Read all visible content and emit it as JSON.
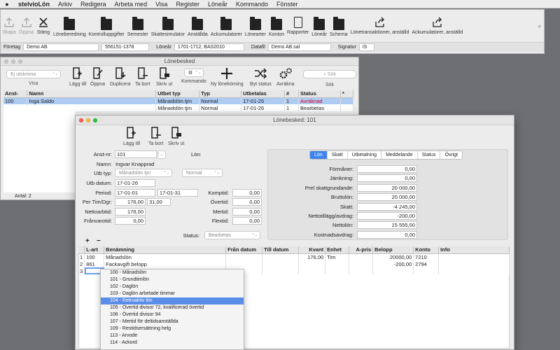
{
  "menubar": {
    "app": "stelvioLön",
    "items": [
      "Arkiv",
      "Redigera",
      "Arbeta med",
      "Visa",
      "Register",
      "Löneår",
      "Kommando",
      "Fönster"
    ]
  },
  "toolbar": {
    "items": [
      {
        "label": "Skapa",
        "icon": "upload-icon",
        "dim": true
      },
      {
        "label": "Öppna",
        "icon": "upload-icon",
        "dim": true
      },
      {
        "label": "Stäng",
        "icon": "close-x-icon",
        "dim": false
      },
      {
        "label": "Löneberedning",
        "icon": "folder-icon"
      },
      {
        "label": "Kontrolluppgifter",
        "icon": "folder-icon"
      },
      {
        "label": "Semester",
        "icon": "folder-icon"
      },
      {
        "label": "Skattesimulator",
        "icon": "folder-icon"
      },
      {
        "label": "Anställda",
        "icon": "folder-icon"
      },
      {
        "label": "Ackumulatorer",
        "icon": "folder-icon"
      },
      {
        "label": "Lönearter",
        "icon": "folder-icon"
      },
      {
        "label": "Konton",
        "icon": "folder-icon"
      },
      {
        "label": "Rapporter",
        "icon": "document-icon"
      },
      {
        "label": "Löneår",
        "icon": "folder-icon"
      },
      {
        "label": "Schema",
        "icon": "folder-icon"
      },
      {
        "label": "Lönetransaktioner, anställd",
        "icon": "share-icon"
      },
      {
        "label": "Ackumulatorer, anställd",
        "icon": "share-icon"
      }
    ],
    "overflow": "»"
  },
  "infobar": {
    "foretag_label": "Företag",
    "foretag_value": "Demo AB",
    "orgnr": "556151-1378",
    "lonear_label": "Löneår",
    "lonear_value": "1701-1712, BAS2010",
    "datafil_label": "Datafil",
    "datafil_value": "Demo AB.sal",
    "signatur_label": "Signatur",
    "signatur_value": "IS"
  },
  "listwin": {
    "title": "Lönebesked",
    "filter": "Ej utskrivna",
    "view_label": "Visa",
    "tools": [
      "Lägg till",
      "Öppna",
      "Duplicera",
      "Ta bort",
      "Skriv ut",
      "Kommando",
      "Ny lönekörning",
      "Byt status",
      "Avräkna"
    ],
    "search_placeholder": "Sök",
    "search_label": "Sök",
    "columns": [
      "Anst-",
      "Namn",
      "Utbet typ",
      "Typ",
      "Utbetalas",
      "#",
      "Status",
      "*"
    ],
    "rows": [
      {
        "anst": "100",
        "namn": "Inga Saldo",
        "utbet": "Månadslön tjm",
        "typ": "Normal",
        "datum": "17-01-26",
        "nr": "1",
        "status": "Avräknad"
      },
      {
        "anst": "101",
        "namn": "Ingvar Knapprad",
        "utbet": "Månadslön tjm",
        "typ": "Normal",
        "datum": "17-01-26",
        "nr": "1",
        "status": "Bearbetas"
      }
    ],
    "count": "Antal: 2"
  },
  "detail": {
    "title": "Lönebesked: 101",
    "tools": [
      "Lägg till",
      "Ta bort",
      "Skriv ut"
    ],
    "anstnr_label": "Anst-nr:",
    "anstnr": "101",
    "lon_label": "Lön:",
    "namn_label": "Namn:",
    "namn": "Ingvar Knapprad",
    "utbtyp_label": "Utb typ:",
    "utbtyp": "Månadslön tjm",
    "typ": "Normal",
    "utbdatum_label": "Utb datum:",
    "utbdatum": "17-01-26",
    "period_label": "Period:",
    "period_from": "17-01-01",
    "period_to": "17-01-31",
    "pertim_label": "Per Tim/Dgr:",
    "pertim": "176,00",
    "perdgr": "31,00",
    "nettoarb_label": "Nettoarbtid:",
    "nettoarb": "176,00",
    "franvaro_label": "Frånvarotid:",
    "franvaro": "0,00",
    "komptid_label": "Komptid:",
    "komptid": "0,00",
    "overtid_label": "Övertid:",
    "overtid": "0,00",
    "mertid_label": "Mertid:",
    "mertid": "0,00",
    "flextid_label": "Flextid:",
    "flextid": "0,00",
    "status_label": "Status:",
    "status": "Bearbetas",
    "tabs": [
      "Lön",
      "Skatt",
      "Utbetalning",
      "Meddelande",
      "Status",
      "Övrigt"
    ],
    "summary": [
      {
        "label": "Förmåner:",
        "value": "0,00"
      },
      {
        "label": "Jämkning:",
        "value": "0,00"
      },
      {
        "label": "Prel skattgrundande:",
        "value": "20 000,00"
      },
      {
        "label": "Bruttolön:",
        "value": "20 000,00"
      },
      {
        "label": "Skatt:",
        "value": "-4 245,00"
      },
      {
        "label": "Nettotillägg/avdrag:",
        "value": "-200,00"
      },
      {
        "label": "Nettolön:",
        "value": "15 555,00"
      },
      {
        "label": "Kostnadsavdrag:",
        "value": "0,00"
      }
    ],
    "add_btn": "+",
    "remove_btn": "−",
    "lines_columns": [
      "L-art",
      "Benämning",
      "Från datum",
      "Till datum",
      "Kvant",
      "Enhet",
      "A-pris",
      "Belopp",
      "Konto",
      "Info"
    ],
    "lines": [
      {
        "n": "1",
        "lart": "100",
        "ben": "Månadslön",
        "kvant": "176,00",
        "enhet": "Tim",
        "belopp": "20000,00",
        "konto": "7210"
      },
      {
        "n": "2",
        "lart": "861",
        "ben": "Fackavgift belopp",
        "kvant": "",
        "enhet": "",
        "belopp": "-200,00",
        "konto": "2794"
      },
      {
        "n": "3",
        "lart": "",
        "ben": "",
        "kvant": "",
        "enhet": "",
        "belopp": "",
        "konto": ""
      }
    ]
  },
  "popup": {
    "items": [
      "100 - Månadslön",
      "101 - Grundtimlön",
      "102 - Daglön",
      "103 - Daglön arbetade timmar",
      "104 - Retroaktiv lön",
      "105 - Övertid divisor 72, kvalificerad övertid",
      "106 - Övertid divisor 94",
      "107 - Mertid för deltidsanställda",
      "109 - Restidsersättning helg",
      "113 - Arvode",
      "114 - Ackord"
    ],
    "highlighted_index": 4
  }
}
